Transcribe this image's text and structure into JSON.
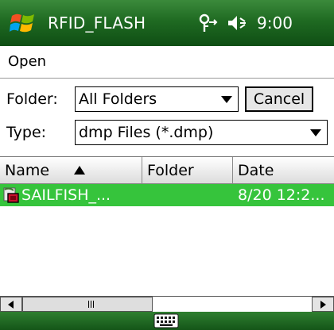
{
  "statusbar": {
    "title": "RFID_FLASH",
    "time": "9:00",
    "icons": [
      "windows-start-icon",
      "connectivity-icon",
      "volume-icon"
    ]
  },
  "dialog": {
    "title": "Open",
    "folder_label": "Folder:",
    "folder_value": "All Folders",
    "type_label": "Type:",
    "type_value": "dmp Files (*.dmp)",
    "cancel_label": "Cancel"
  },
  "list": {
    "columns": [
      "Name",
      "Folder",
      "Date"
    ],
    "sort_icon": "sort-ascending-icon",
    "rows": [
      {
        "name": "SAILFISH_...",
        "folder": "",
        "date": "8/20 12:2...",
        "selected": true
      }
    ]
  },
  "softkeys": {
    "icon": "keyboard-icon"
  },
  "colors": {
    "titlebar_green": "#1f6a22",
    "selection_green": "#36c43c",
    "softbar_green": "#145518"
  }
}
